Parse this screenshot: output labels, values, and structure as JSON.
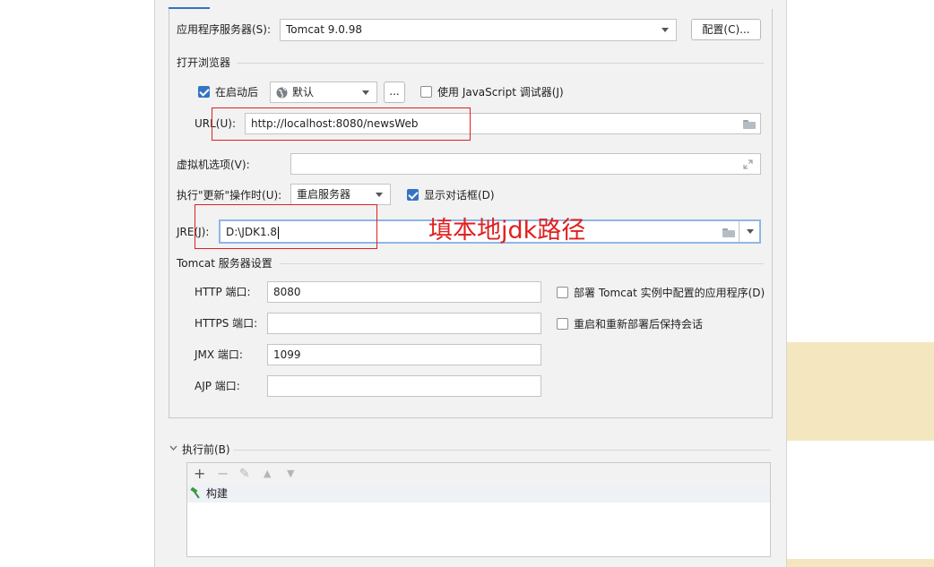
{
  "app_server": {
    "label": "应用程序服务器(S):",
    "value": "Tomcat 9.0.98",
    "configure_button": "配置(C)..."
  },
  "browser": {
    "section_label": "打开浏览器",
    "after_launch_label": "在启动后",
    "after_launch_checked": true,
    "browser_value": "默认",
    "more_button": "...",
    "js_debugger_label": "使用 JavaScript 调试器(J)",
    "js_debugger_checked": false,
    "url_label": "URL(U):",
    "url_value": "http://localhost:8080/newsWeb"
  },
  "vm_options": {
    "label": "虚拟机选项(V):",
    "value": ""
  },
  "on_update": {
    "label": "执行\"更新\"操作时(U):",
    "value": "重启服务器",
    "show_dialog_label": "显示对话框(D)",
    "show_dialog_checked": true
  },
  "jre": {
    "label": "JRE(J):",
    "value": "D:\\JDK1.8"
  },
  "annotation": {
    "text": "填本地jdk路径",
    "color": "#e02020"
  },
  "tomcat_settings": {
    "section_label": "Tomcat 服务器设置",
    "http_port_label": "HTTP 端口:",
    "http_port_value": "8080",
    "https_port_label": "HTTPS 端口:",
    "https_port_value": "",
    "jmx_port_label": "JMX 端口:",
    "jmx_port_value": "1099",
    "ajp_port_label": "AJP 端口:",
    "ajp_port_value": "",
    "deploy_apps_label": "部署 Tomcat 实例中配置的应用程序(D)",
    "deploy_apps_checked": false,
    "keep_sessions_label": "重启和重新部署后保持会话",
    "keep_sessions_checked": false
  },
  "before_launch": {
    "section_label": "执行前(B)",
    "items": [
      {
        "icon": "hammer-icon",
        "label": "构建"
      }
    ]
  },
  "colors": {
    "accent": "#3574c4",
    "annotation_red": "#e02020",
    "side_yellow": "#f4e7c0"
  }
}
